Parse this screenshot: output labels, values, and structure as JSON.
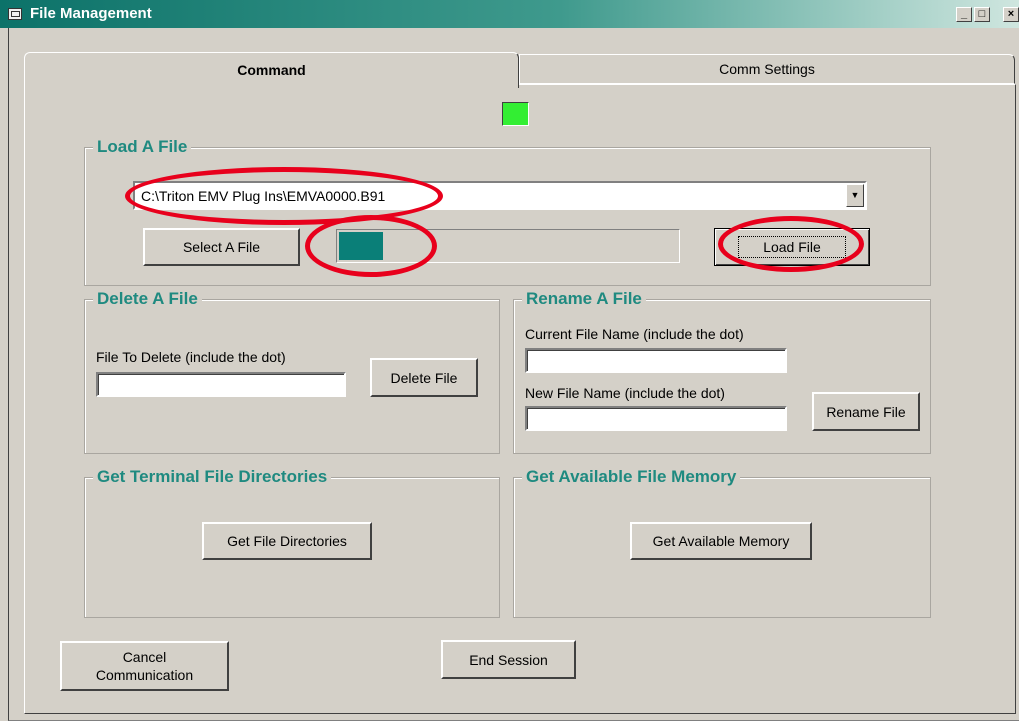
{
  "window": {
    "title": "File Management",
    "controls": {
      "minimize": "_",
      "maximize": "□",
      "close": "×"
    }
  },
  "tabs": [
    {
      "label": "Command",
      "active": true
    },
    {
      "label": "Comm Settings",
      "active": false
    }
  ],
  "status_indicator_color": "#33ee33",
  "load_file": {
    "group_label": "Load A File",
    "path_value": "C:\\Triton EMV Plug Ins\\EMVA0000.B91",
    "dropdown_arrow": "▼",
    "select_button": "Select A File",
    "load_button": "Load File",
    "progress_fraction": 0.13
  },
  "delete_file": {
    "group_label": "Delete A File",
    "field_label": "File To Delete (include the dot)",
    "field_value": "",
    "button": "Delete File"
  },
  "rename_file": {
    "group_label": "Rename A File",
    "current_label": "Current File Name (include the dot)",
    "current_value": "",
    "new_label": "New File Name (include the dot)",
    "new_value": "",
    "button": "Rename File"
  },
  "directories": {
    "group_label": "Get Terminal File Directories",
    "button": "Get File Directories"
  },
  "memory": {
    "group_label": "Get Available File Memory",
    "button": "Get Available Memory"
  },
  "footer": {
    "cancel_button": "Cancel\nCommunication",
    "end_button": "End Session"
  },
  "colors": {
    "accent_text": "#1f8a80",
    "progress_fill": "#0a7f78",
    "annotation_ring": "#e8001c"
  }
}
